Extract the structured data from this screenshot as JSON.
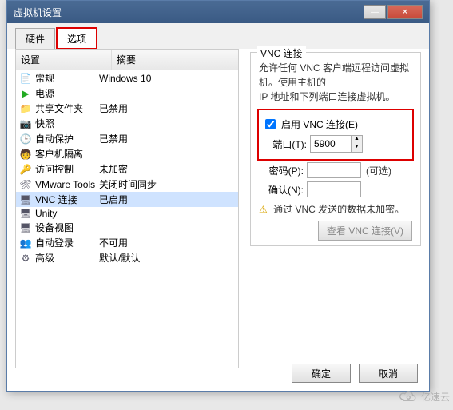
{
  "window": {
    "title": "虚拟机设置"
  },
  "tabs": {
    "hardware": "硬件",
    "options": "选项"
  },
  "list": {
    "head_setting": "设置",
    "head_summary": "摘要",
    "rows": [
      {
        "icon": "📄",
        "name": "常规",
        "summary": "Windows 10"
      },
      {
        "icon": "▶",
        "icon_color": "#2a2",
        "name": "电源",
        "summary": ""
      },
      {
        "icon": "📁",
        "name": "共享文件夹",
        "summary": "已禁用"
      },
      {
        "icon": "📷",
        "name": "快照",
        "summary": ""
      },
      {
        "icon": "🕒",
        "name": "自动保护",
        "summary": "已禁用"
      },
      {
        "icon": "🧑",
        "name": "客户机隔离",
        "summary": ""
      },
      {
        "icon": "🔑",
        "name": "访问控制",
        "summary": "未加密"
      },
      {
        "icon": "🛠",
        "name": "VMware Tools",
        "summary": "关闭时间同步"
      },
      {
        "icon": "🖥",
        "name": "VNC 连接",
        "summary": "已启用",
        "selected": true
      },
      {
        "icon": "🖥",
        "name": "Unity",
        "summary": ""
      },
      {
        "icon": "🖥",
        "name": "设备视图",
        "summary": ""
      },
      {
        "icon": "👥",
        "icon_color": "#e0b000",
        "name": "自动登录",
        "summary": "不可用"
      },
      {
        "icon": "⚙",
        "name": "高级",
        "summary": "默认/默认"
      }
    ]
  },
  "vnc": {
    "group_title": "VNC 连接",
    "desc_line1": "允许任何 VNC 客户端远程访问虚拟机。使用主机的",
    "desc_line2": "IP 地址和下列端口连接虚拟机。",
    "enable_label": "启用 VNC 连接(E)",
    "enable_checked": true,
    "port_label": "端口(T):",
    "port_value": "5900",
    "password_label": "密码(P):",
    "password_hint": "(可选)",
    "confirm_label": "确认(N):",
    "warn_text": "通过 VNC 发送的数据未加密。",
    "view_btn": "查看 VNC 连接(V)"
  },
  "footer": {
    "ok": "确定",
    "cancel": "取消"
  },
  "watermark": "亿速云"
}
